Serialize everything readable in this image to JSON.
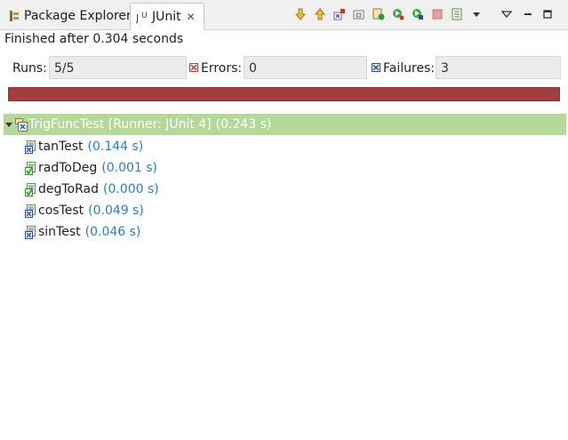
{
  "tabs": {
    "package_explorer": "Package Explorer",
    "junit": "JUnit"
  },
  "status": "Finished after 0.304 seconds",
  "counters": {
    "runs_label": "Runs:",
    "runs_value": "5/5",
    "errors_label": "Errors:",
    "errors_value": "0",
    "failures_label": "Failures:",
    "failures_value": "3"
  },
  "progress": {
    "state": "failed",
    "color": "#a03f3f",
    "fraction": 1.0
  },
  "toolbar": {
    "icons": [
      "next-failure-icon",
      "previous-failure-icon",
      "show-failures-only-icon",
      "scroll-lock-icon",
      "rerun-test-icon",
      "rerun-failed-first-icon",
      "stop-icon",
      "test-run-history-icon",
      "history-dropdown-icon",
      "view-menu-icon",
      "minimize-icon",
      "maximize-icon"
    ]
  },
  "tree": {
    "root": {
      "name": "TrigFuncTest [Runner: JUnit 4]",
      "time": "(0.243 s)",
      "status": "failed",
      "expanded": true
    },
    "children": [
      {
        "name": "tanTest",
        "time": "(0.144 s)",
        "status": "failed"
      },
      {
        "name": "radToDeg",
        "time": "(0.001 s)",
        "status": "passed"
      },
      {
        "name": "degToRad",
        "time": "(0.000 s)",
        "status": "passed"
      },
      {
        "name": "cosTest",
        "time": "(0.049 s)",
        "status": "failed"
      },
      {
        "name": "sinTest",
        "time": "(0.046 s)",
        "status": "failed"
      }
    ]
  },
  "colors": {
    "failure_bar": "#a03f3f",
    "root_highlight": "#b3d897",
    "time_text": "#2b7fb6"
  }
}
